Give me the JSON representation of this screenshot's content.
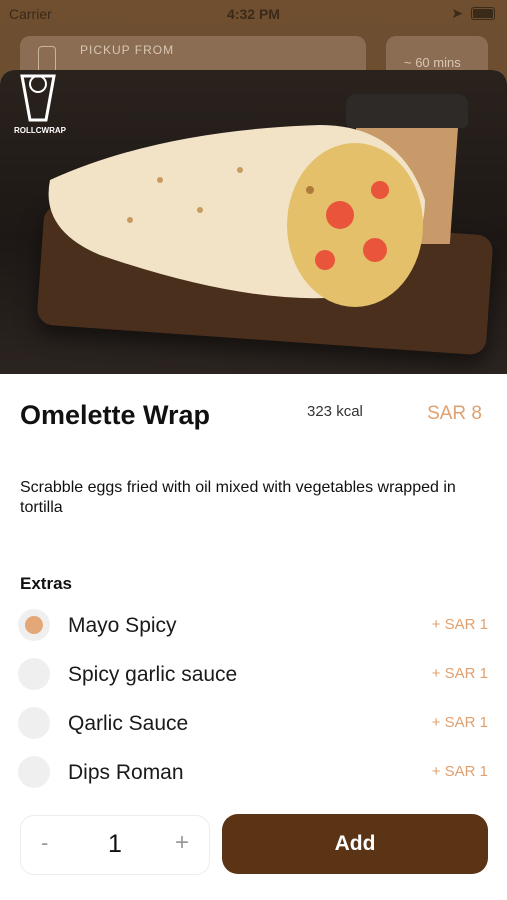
{
  "status_bar": {
    "carrier": "Carrier",
    "time": "4:32 PM"
  },
  "background": {
    "pickup_label": "PICKUP FROM",
    "eta": "~ 60 mins"
  },
  "product": {
    "name": "Omelette Wrap",
    "calories": "323 kcal",
    "price": "SAR 8",
    "description": "Scrabble eggs fried with oil mixed with vegetables wrapped in tortilla",
    "logo_text": "ROLLCWRAP"
  },
  "extras": {
    "title": "Extras",
    "items": [
      {
        "name": "Mayo Spicy",
        "price": "+ SAR 1",
        "selected": true
      },
      {
        "name": "Spicy garlic sauce",
        "price": "+ SAR 1",
        "selected": false
      },
      {
        "name": "Qarlic Sauce",
        "price": "+ SAR 1",
        "selected": false
      },
      {
        "name": "Dips Roman",
        "price": "+ SAR 1",
        "selected": false
      }
    ]
  },
  "quantity": {
    "minus": "-",
    "value": "1",
    "plus": "+"
  },
  "add_button": {
    "label": "Add"
  },
  "colors": {
    "accent": "#e0a06f",
    "primary": "#5b3415",
    "selected_radio": "#e4a878"
  }
}
